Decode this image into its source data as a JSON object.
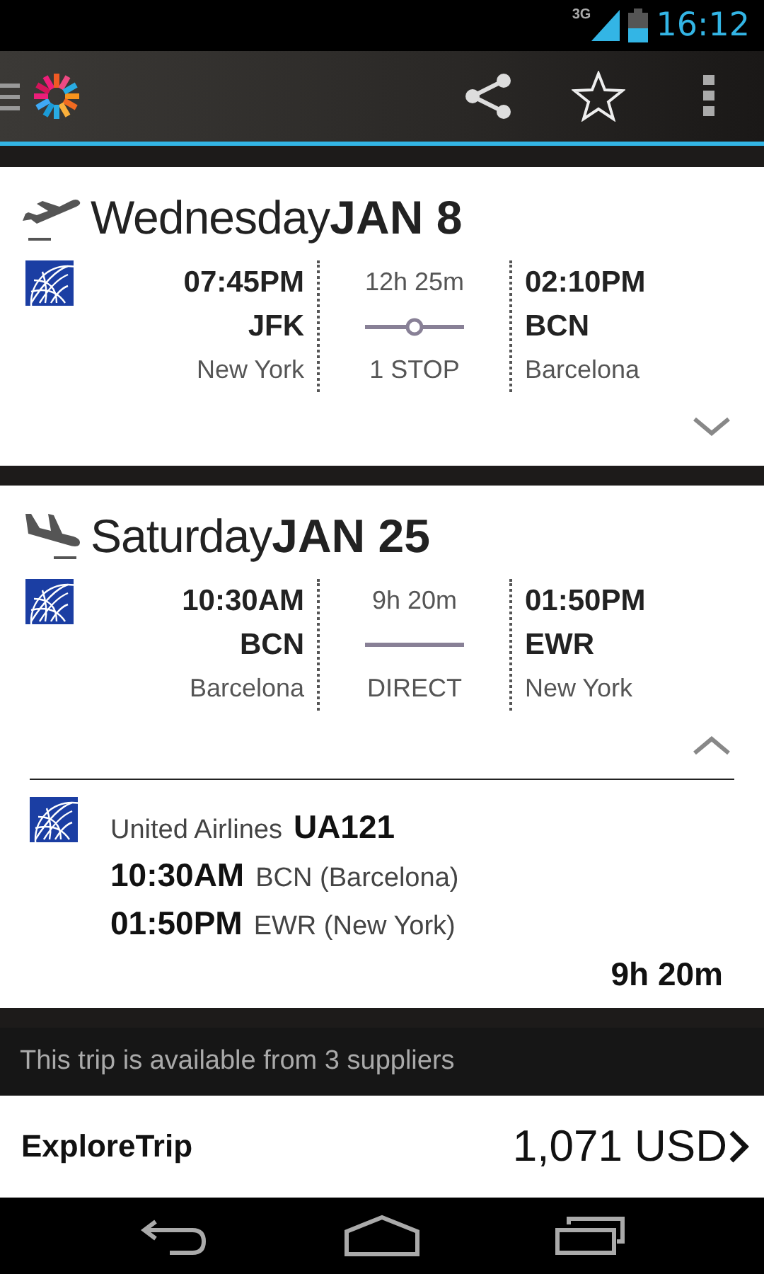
{
  "status_bar": {
    "network": "3G",
    "time": "16:12"
  },
  "legs": [
    {
      "kind": "departure",
      "weekday": "Wednesday",
      "date": "JAN 8",
      "depart": {
        "time": "07:45PM",
        "code": "JFK",
        "city": "New York"
      },
      "duration": "12h 25m",
      "route": {
        "kind": "stop"
      },
      "stops": "1 STOP",
      "arrive": {
        "time": "02:10PM",
        "code": "BCN",
        "city": "Barcelona"
      },
      "expanded": false
    },
    {
      "kind": "return",
      "weekday": "Saturday",
      "date": "JAN 25",
      "depart": {
        "time": "10:30AM",
        "code": "BCN",
        "city": "Barcelona"
      },
      "duration": "9h 20m",
      "route": {
        "kind": "direct"
      },
      "stops": "DIRECT",
      "arrive": {
        "time": "01:50PM",
        "code": "EWR",
        "city": "New York"
      },
      "expanded": true,
      "segment": {
        "airline": "United Airlines",
        "flight": "UA121",
        "depart_time": "10:30AM",
        "depart_place": "BCN (Barcelona)",
        "arrive_time": "01:50PM",
        "arrive_place": "EWR (New York)",
        "duration": "9h 20m"
      }
    }
  ],
  "suppliers_note": "This trip is available from 3 suppliers",
  "offer": {
    "supplier": "ExploreTrip",
    "price": "1,071 USD"
  }
}
